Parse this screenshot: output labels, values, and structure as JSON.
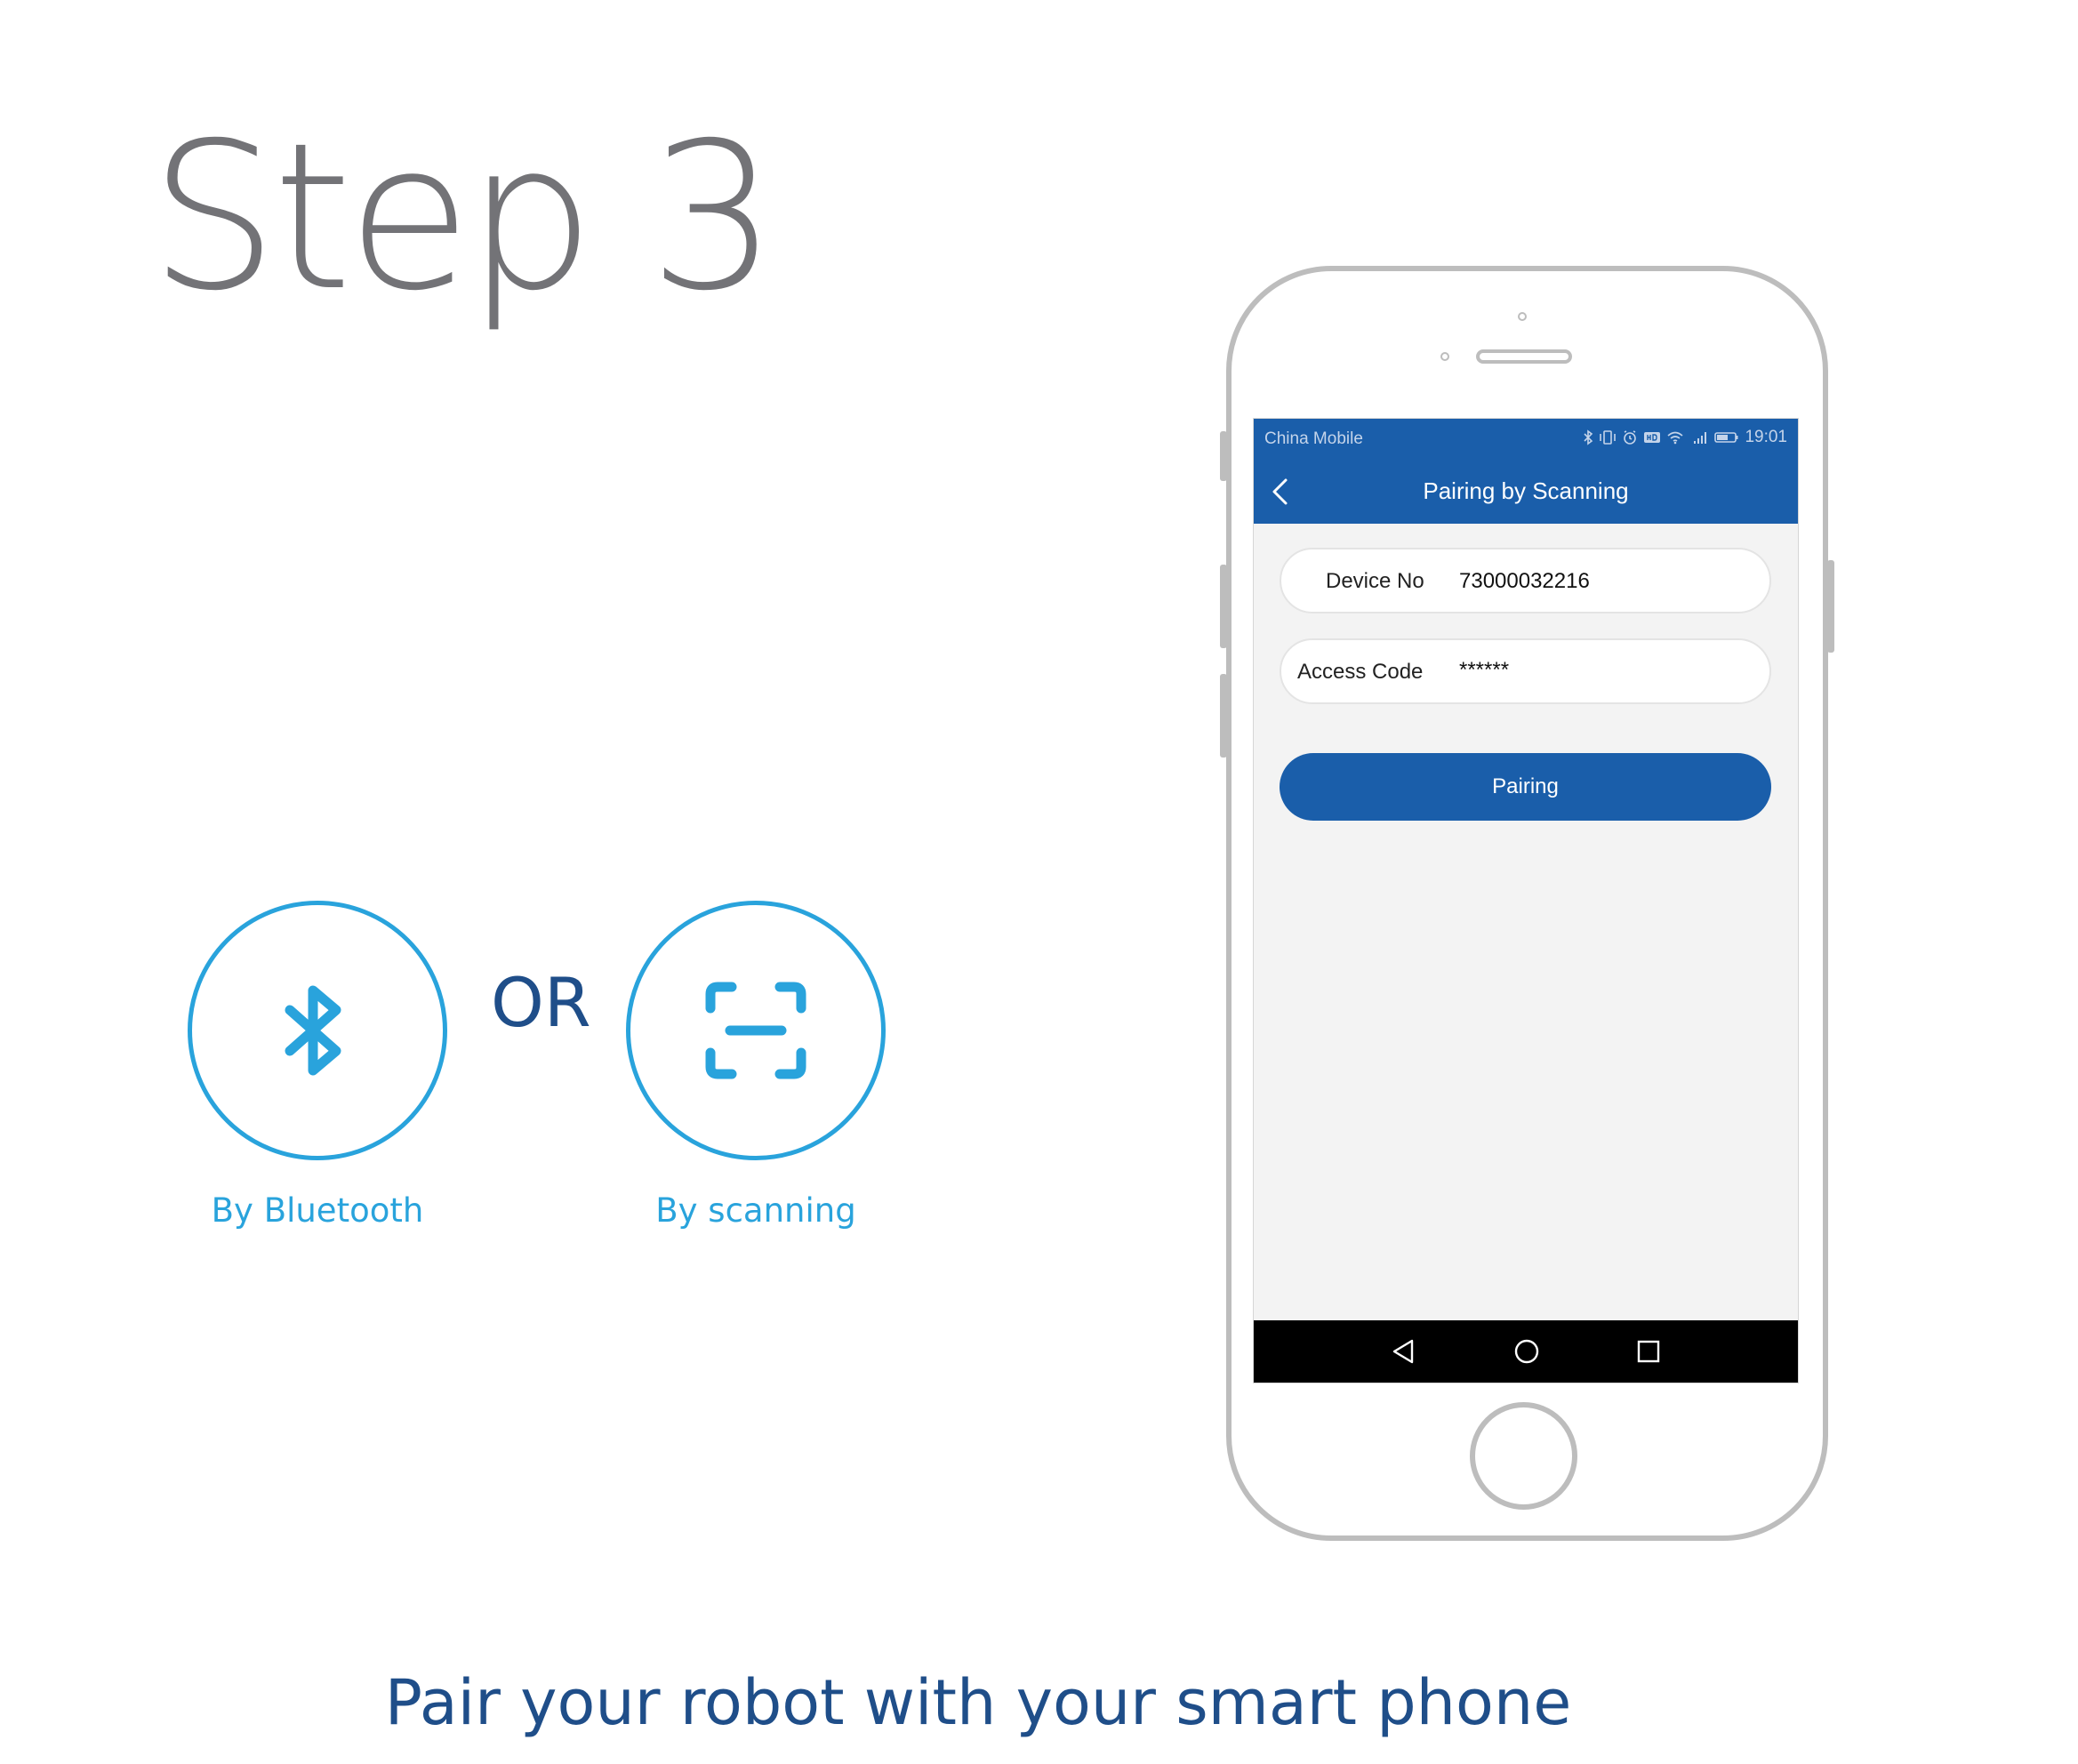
{
  "heading": "Step 3",
  "options": {
    "bluetooth": {
      "label": "By Bluetooth",
      "icon": "bluetooth-icon"
    },
    "separator": "OR",
    "scanning": {
      "label": "By scanning",
      "icon": "scan-icon"
    }
  },
  "tagline": "Pair your robot with your smart phone",
  "phone": {
    "status_bar": {
      "carrier": "China Mobile",
      "time": "19:01",
      "icons": [
        "bluetooth-icon",
        "vibrate-icon",
        "alarm-icon",
        "hd-icon",
        "wifi-icon",
        "signal-icon",
        "battery-icon"
      ]
    },
    "header": {
      "title": "Pairing by Scanning",
      "back_icon": "chevron-left-icon"
    },
    "form": {
      "device_no_label": "Device No",
      "device_no_value": "73000032216",
      "access_code_label": "Access Code",
      "access_code_value": "******",
      "pair_button": "Pairing"
    },
    "nav_bar": [
      "back-triangle-icon",
      "home-circle-icon",
      "recent-square-icon"
    ]
  },
  "colors": {
    "title_gray": "#737377",
    "accent_cyan": "#29a3dc",
    "navy": "#1f4e89",
    "app_blue": "#1a5eaa"
  }
}
